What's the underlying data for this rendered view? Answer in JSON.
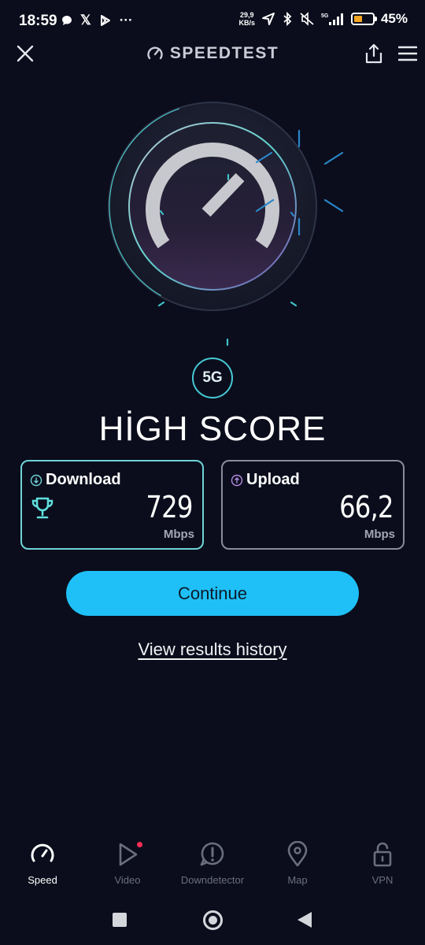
{
  "status_bar": {
    "time": "18:59",
    "speed_value": "29,9",
    "speed_unit": "KB/s",
    "network": "5G",
    "battery_percent": "45%",
    "battery_level": 0.45,
    "left_icons": [
      "chat-bubble-icon",
      "x-icon",
      "play-store-icon",
      "more-icon"
    ],
    "right_icons": [
      "location-icon",
      "bluetooth-icon",
      "mute-icon",
      "signal-icon",
      "battery-icon"
    ]
  },
  "header": {
    "title": "SPEEDTEST"
  },
  "gauge": {
    "state": "complete"
  },
  "badge": "5G",
  "headline": "HİGH SCORE",
  "results": {
    "download": {
      "label": "Download",
      "value": "729",
      "unit": "Mbps",
      "icon": "trophy-icon"
    },
    "upload": {
      "label": "Upload",
      "value": "66,2",
      "unit": "Mbps"
    }
  },
  "continue_label": "Continue",
  "history_label": "View results history",
  "bottom_nav": [
    {
      "label": "Speed",
      "icon": "speedometer-icon",
      "active": true
    },
    {
      "label": "Video",
      "icon": "play-icon",
      "active": false
    },
    {
      "label": "Downdetector",
      "icon": "alert-icon",
      "active": false
    },
    {
      "label": "Map",
      "icon": "map-pin-icon",
      "active": false
    },
    {
      "label": "VPN",
      "icon": "lock-icon",
      "active": false
    }
  ],
  "colors": {
    "background": "#0b0d1c",
    "accent": "#1fc0f7",
    "download_border": "#6fd3d6",
    "upload_border": "#8a8c99",
    "video_dot": "#ff2d55"
  }
}
